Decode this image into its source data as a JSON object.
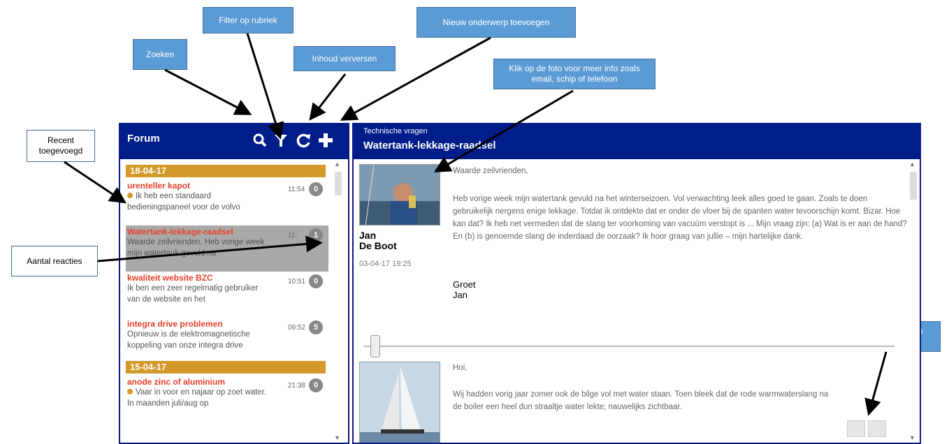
{
  "callouts": {
    "filter": "Filter op rubriek",
    "add": "Nieuw onderwerp toevoegen",
    "search": "Zoeken",
    "refresh": "Inhoud verversen",
    "photo_info": "Klik op de foto voor meer info zoals  email, schip of telefoon",
    "recent": "Recent toegevoegd",
    "count": "Aantal reacties",
    "scroll": "Scroll naar boven of beneden"
  },
  "forum": {
    "title": "Forum",
    "icons": [
      "search-icon",
      "filter-icon",
      "refresh-icon",
      "add-icon"
    ],
    "groups": [
      {
        "date": "18-04-17",
        "items": [
          {
            "title": "urenteller kapot",
            "text": "Ik heb een standaard bedieningspaneel voor de volvo",
            "time": "11:54",
            "count": "0",
            "recent": true
          },
          {
            "title": "Watertank-lekkage-raadsel",
            "text": "Waarde zeilvrienden, Heb vorige week mijn watertank gevuld na",
            "time": "11:",
            "count": "1",
            "recent": false,
            "selected": true
          },
          {
            "title": "kwaliteit website BZC",
            "text": "Ik ben een zeer regelmatig gebruiker van de website en het",
            "time": "10:51",
            "count": "0",
            "recent": false
          },
          {
            "title": "integra drive problemen",
            "text": "Opnieuw is de elektromagnetische koppeling van onze integra drive",
            "time": "09:52",
            "count": "5",
            "recent": false
          }
        ]
      },
      {
        "date": "15-04-17",
        "items": [
          {
            "title": "anode zinc of aluminium",
            "text": "Vaar in voor en najaar op zoet water.  In maanden juli/aug op",
            "time": "21:38",
            "count": "0",
            "recent": true
          }
        ]
      }
    ]
  },
  "topic": {
    "category": "Technische vragen",
    "title": "Watertank-lekkage-raadsel",
    "posts": [
      {
        "author_first": "Jan",
        "author_last": "De Boot",
        "date": "03-04-17 19:25",
        "greeting": "Waarde zeilvrienden,",
        "body": "Heb vorige week mijn watertank gevuld na het winterseizoen. Vol verwachting leek alles goed te gaan. Zoals te doen gebruikelijk nergens enige lekkage. Totdat ik ontdekte dat er onder de vloer bij de spanten water tevoorschijn komt. Bizar. Hoe kan dat? Ik heb net vermeden dat de slang ter voorkoming van vacuüm verstopt is ... Mijn vraag zijn: (a) Wat is er aan de hand? En (b) is genoemde slang de inderdaad de oorzaak?  Ik hoor graag van jullie – mijn hartelijke dank.",
        "sign_1": "Groet",
        "sign_2": "Jan"
      },
      {
        "greeting": "Hoi,",
        "body": "Wij hadden vorig jaar zomer ook de bilge vol met water staan. Toen bleek dat de rode warmwaterslang na de boiler een heel dun straaltje water lekte; nauwelijks zichtbaar."
      }
    ]
  },
  "colors": {
    "header": "#001d8a",
    "accent": "#d39a2a",
    "title_red": "#e8402a",
    "callout": "#5b9bd5"
  }
}
